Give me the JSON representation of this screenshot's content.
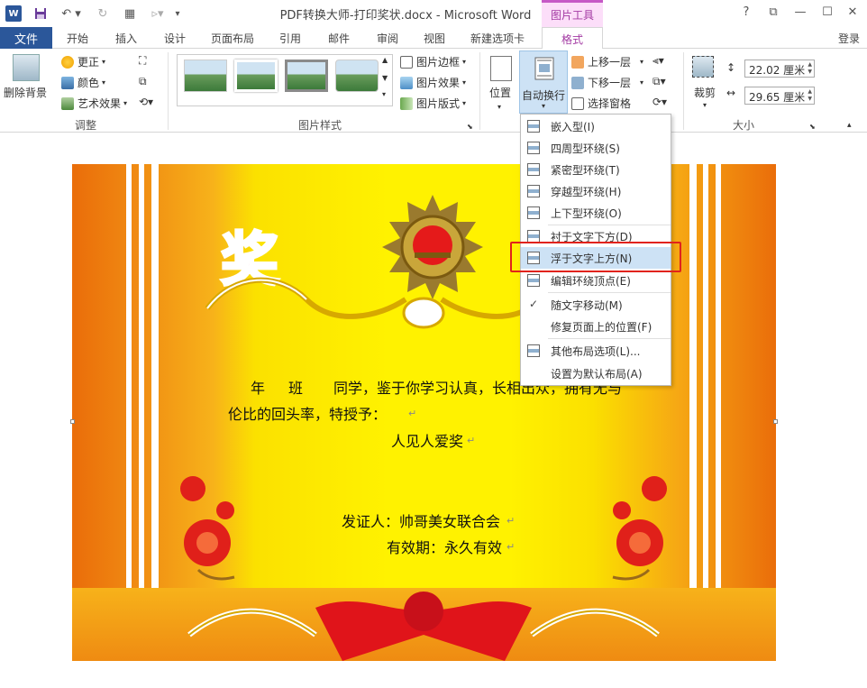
{
  "titlebar": {
    "app_logo": "W",
    "title": "PDF转换大师-打印奖状.docx - Microsoft Word",
    "contextual_tab": "图片工具",
    "help": "?",
    "restore": "⧉",
    "minimize": "—",
    "maximize": "☐",
    "close": "✕"
  },
  "tabs": {
    "file": "文件",
    "items": [
      "开始",
      "插入",
      "设计",
      "页面布局",
      "引用",
      "邮件",
      "审阅",
      "视图",
      "新建选项卡",
      "格式"
    ],
    "login": "登录"
  },
  "ribbon": {
    "adjust": {
      "remove_bg": "删除背景",
      "corrections": "更正",
      "color": "颜色",
      "artistic": "艺术效果",
      "label": "调整"
    },
    "styles": {
      "border": "图片边框",
      "effects": "图片效果",
      "layout": "图片版式",
      "label": "图片样式"
    },
    "arrange": {
      "position": "位置",
      "wrap_text": "自动换行",
      "bring_forward": "上移一层",
      "send_backward": "下移一层",
      "selection_pane": "选择窗格"
    },
    "size": {
      "crop": "裁剪",
      "height": "22.02 厘米",
      "width": "29.65 厘米",
      "label": "大小"
    }
  },
  "wrap_menu": {
    "items": [
      "嵌入型(I)",
      "四周型环绕(S)",
      "紧密型环绕(T)",
      "穿越型环绕(H)",
      "上下型环绕(O)",
      "衬于文字下方(D)",
      "浮于文字上方(N)",
      "编辑环绕顶点(E)",
      "随文字移动(M)",
      "修复页面上的位置(F)",
      "其他布局选项(L)...",
      "设置为默认布局(A)"
    ],
    "checkmark": "✓"
  },
  "certificate": {
    "heading": "奖",
    "line1_grade": "年",
    "line1_class": "班",
    "line1_rest": "同学，鉴于你学习认真，长相出众，拥有无与",
    "line2": "伦比的回头率，特授予：",
    "award": "人见人爱奖",
    "issuer": "发证人：帅哥美女联合会",
    "validity": "有效期：永久有效",
    "pilcrow": "↵"
  },
  "colors": {
    "word_blue": "#2b579a",
    "picture_tools_pink": "#fcdef9",
    "highlight_red": "#e1231b",
    "cert_orange": "#ea6d0a",
    "cert_yellow": "#fff200"
  }
}
